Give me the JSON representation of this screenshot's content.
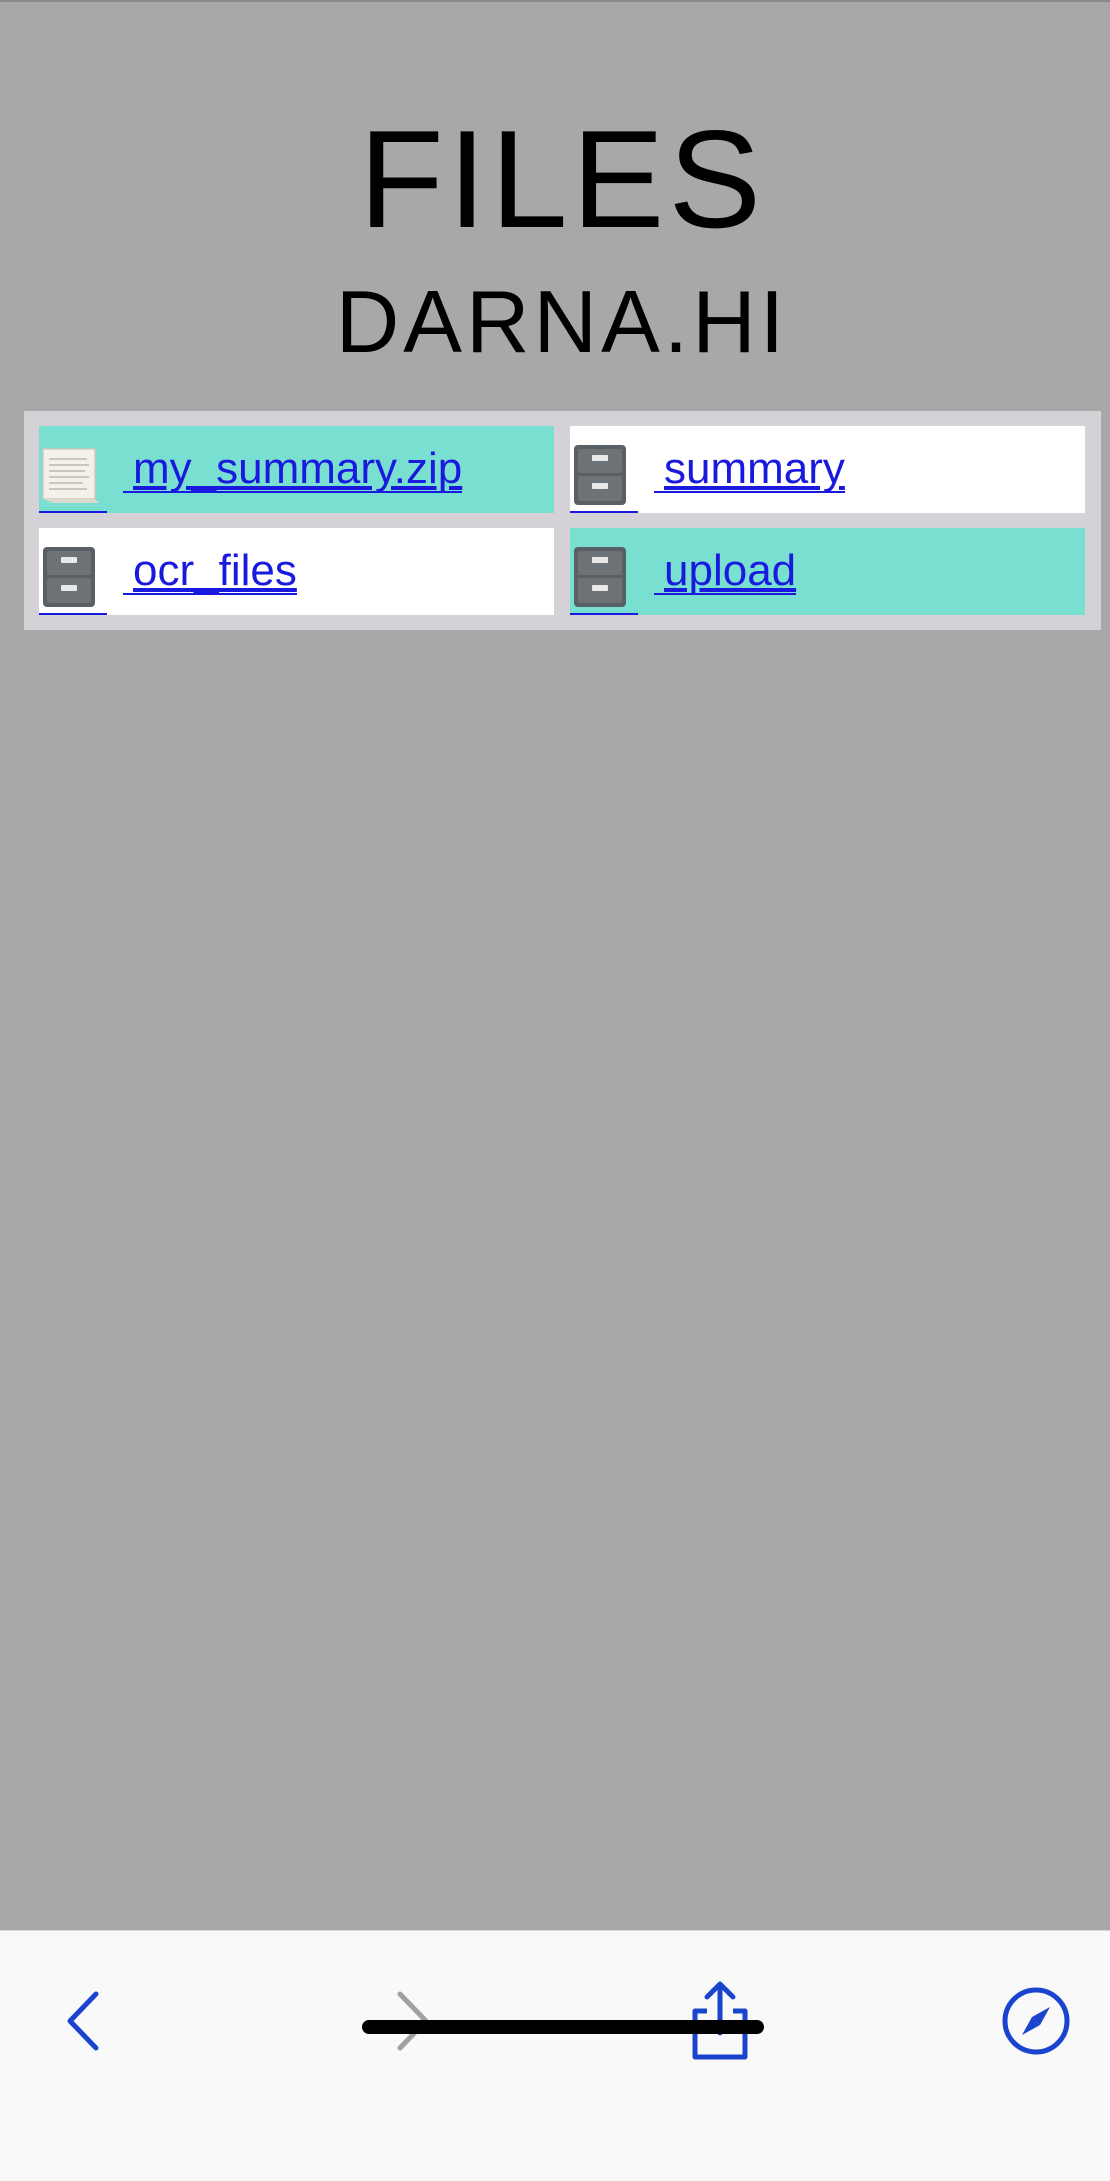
{
  "header": {
    "title": "FILES",
    "subtitle": "DARNA.HI"
  },
  "files": [
    {
      "name": " my_summary.zip",
      "icon": "document-icon",
      "type": "file",
      "highlight_color": "#78dfd1"
    },
    {
      "name": " summary",
      "icon": "file-cabinet-icon",
      "type": "folder",
      "highlight_color": "#ffffff"
    },
    {
      "name": " ocr_files",
      "icon": "file-cabinet-icon",
      "type": "folder",
      "highlight_color": "#ffffff"
    },
    {
      "name": " upload",
      "icon": "file-cabinet-icon",
      "type": "folder",
      "highlight_color": "#78dfd1"
    }
  ],
  "toolbar": {
    "back_icon": "chevron-left-icon",
    "forward_icon": "chevron-right-icon",
    "share_icon": "share-icon",
    "safari_icon": "compass-icon"
  },
  "colors": {
    "background": "#a8a8a8",
    "table_border": "#d4d2d7",
    "teal": "#78dfd1",
    "link": "#1a1adf",
    "toolbar_accent": "#1a44d0",
    "toolbar_disabled": "#a0a0a0"
  }
}
